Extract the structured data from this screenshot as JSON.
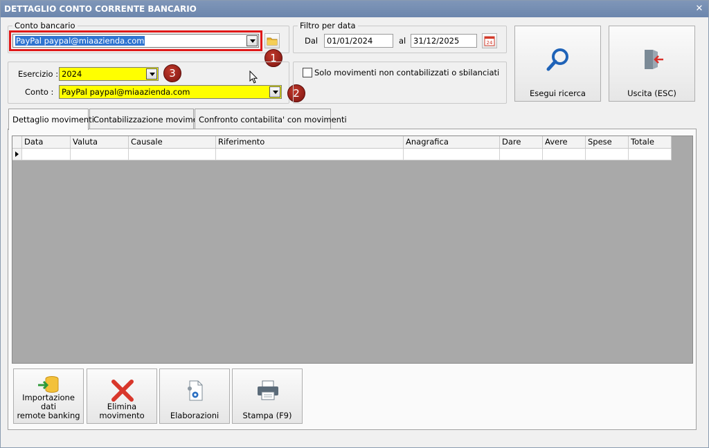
{
  "window": {
    "title": "DETTAGLIO CONTO CORRENTE BANCARIO",
    "close_glyph": "✕"
  },
  "conto_bancario": {
    "label": "Conto bancario",
    "value": "PayPal paypal@miaazienda.com"
  },
  "filtro_data": {
    "label": "Filtro per data",
    "dal_label": "Dal",
    "dal_value": "01/01/2024",
    "al_label": "al",
    "al_value": "31/12/2025",
    "calendar_text": "24"
  },
  "esercizio": {
    "label": "Esercizio :",
    "value": "2024"
  },
  "conto": {
    "label": "Conto :",
    "value": "PayPal paypal@miaazienda.com"
  },
  "checkbox": {
    "label": "Solo movimenti non contabilizzati o sbilanciati",
    "checked": false
  },
  "badges": {
    "one": "1",
    "two": "2",
    "three": "3"
  },
  "buttons": {
    "search": "Esegui ricerca",
    "exit": "Uscita (ESC)",
    "import_line1": "Importazione dati",
    "import_line2": "remote banking",
    "delete": "Elimina movimento",
    "elab": "Elaborazioni",
    "print": "Stampa (F9)"
  },
  "tabs": [
    "Dettaglio movimenti",
    "Contabilizzazione movimenti",
    "Confronto contabilita' con movimenti"
  ],
  "table": {
    "columns": [
      "Data",
      "Valuta",
      "Causale",
      "Riferimento",
      "Anagrafica",
      "Dare",
      "Avere",
      "Spese",
      "Totale"
    ]
  },
  "colors": {
    "title_bar": "#6c86ad",
    "highlight": "#e01818",
    "badge": "#9b1b14",
    "yellow_field": "#ffff00",
    "selection": "#2f74d0",
    "grid_bg": "#a9a9a9"
  }
}
